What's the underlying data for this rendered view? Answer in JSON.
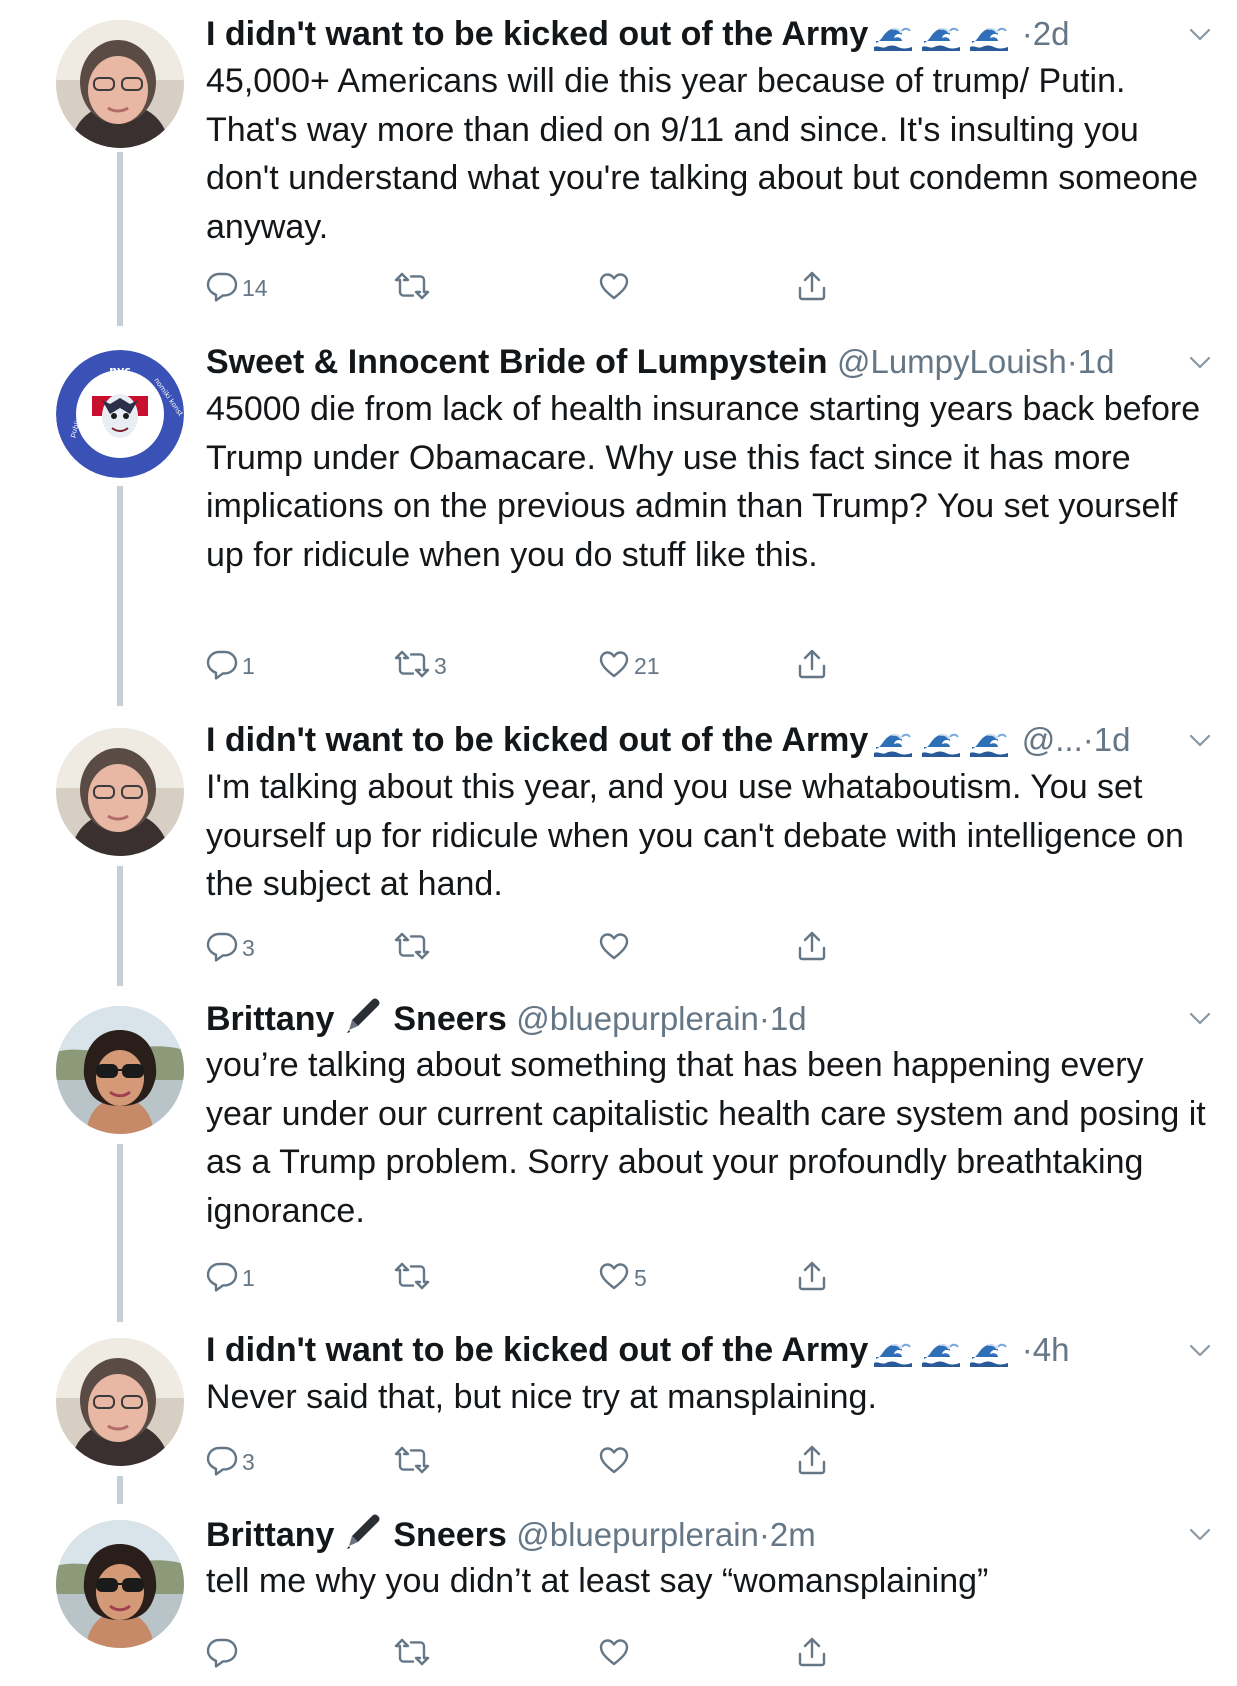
{
  "tweets": [
    {
      "name": "I didn't want to be kicked out of the Army",
      "name_emoji": "🌊🌊🌊",
      "handle": "",
      "dot": "·",
      "time": "2d",
      "text": "45,000+ Americans will die this year because of trump/ Putin. That's way more than died on 9/11 and since. It's insulting you don't understand what you're talking about but condemn someone anyway.",
      "replies": "14",
      "retweets": "",
      "likes": ""
    },
    {
      "name": "Sweet & Innocent Bride of Lumpystein",
      "handle": "@LumpyLouish",
      "dot": "·",
      "time": "1d",
      "avatar_text": "nyc",
      "avatar_ring_left": "public advocate",
      "avatar_ring_right": "nomiki konst",
      "text": "45000 die from lack of health insurance starting years back before Trump under Obamacare. Why use this fact since it has more implications on the previous admin than Trump? You set yourself up for ridicule when you do stuff like this.",
      "replies": "1",
      "retweets": "3",
      "likes": "21"
    },
    {
      "name": "I didn't want to be kicked out of the Army",
      "name_emoji": "🌊🌊🌊",
      "handle": "@...",
      "dot": "·",
      "time": "1d",
      "text": "I'm talking about this year, and you use whataboutism. You set yourself up for ridicule when you can't debate with intelligence on the subject at hand.",
      "replies": "3",
      "retweets": "",
      "likes": ""
    },
    {
      "name": "Brittany",
      "name_emoji": "✒️",
      "name_after": "Sneers",
      "handle": "@bluepurplerain",
      "dot": "·",
      "time": "1d",
      "text": "you’re talking about something that has been happening every year under our current capitalistic health care system and posing it as a Trump problem. Sorry about your profoundly breathtaking ignorance.",
      "replies": "1",
      "retweets": "",
      "likes": "5"
    },
    {
      "name": "I didn't want to be kicked out of the Army",
      "name_emoji": "🌊🌊🌊",
      "handle": "",
      "dot": "·",
      "time": "4h",
      "text": "Never said that, but nice try at mansplaining.",
      "replies": "3",
      "retweets": "",
      "likes": ""
    },
    {
      "name": "Brittany",
      "name_emoji": "✒️",
      "name_after": "Sneers",
      "handle": "@bluepurplerain",
      "dot": "·",
      "time": "2m",
      "text": "tell me why you didn’t at least say “womansplaining”",
      "replies": "",
      "retweets": "",
      "likes": ""
    }
  ],
  "icons": {
    "reply": "reply-icon",
    "retweet": "retweet-icon",
    "like": "heart-icon",
    "share": "share-icon",
    "caret": "chevron-down-icon"
  },
  "colors": {
    "text": "#14171a",
    "muted": "#657786",
    "thread_line": "#c4cfd6",
    "icon": "#657786"
  }
}
